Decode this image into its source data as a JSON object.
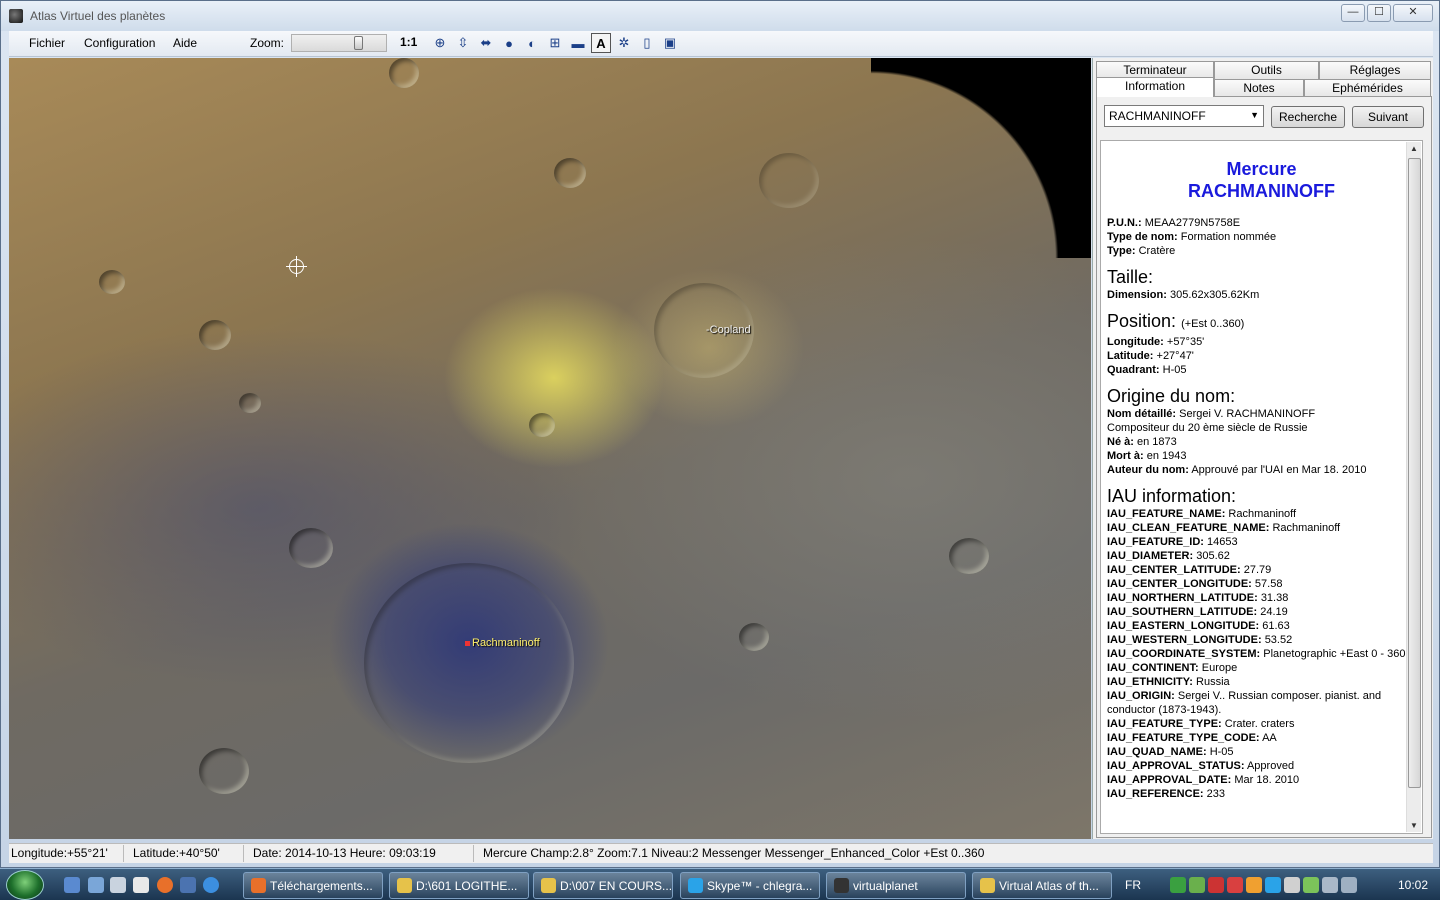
{
  "window": {
    "title": "Atlas Virtuel des planètes",
    "minimize": "—",
    "maximize": "☐",
    "close": "✕"
  },
  "menu": {
    "file": "Fichier",
    "config": "Configuration",
    "help": "Aide"
  },
  "toolbar": {
    "zoom_label": "Zoom:",
    "zoom_ratio": "1:1",
    "zoom_level": 0.65,
    "tools": [
      {
        "name": "globe-grid-icon",
        "glyph": "⊕"
      },
      {
        "name": "flip-vertical-icon",
        "glyph": "⇳"
      },
      {
        "name": "flip-horizontal-icon",
        "glyph": "⬌"
      },
      {
        "name": "planet-icon",
        "glyph": "●"
      },
      {
        "name": "terminator-icon",
        "glyph": "◐"
      },
      {
        "name": "grid-globe-icon",
        "glyph": "⊞"
      },
      {
        "name": "ruler-icon",
        "glyph": "▬"
      },
      {
        "name": "labels-icon",
        "glyph": "A"
      },
      {
        "name": "settings-icon",
        "glyph": "✲"
      },
      {
        "name": "page-icon",
        "glyph": "▯"
      },
      {
        "name": "screen-icon",
        "glyph": "▣"
      }
    ]
  },
  "map": {
    "labels": {
      "copland": "-Copland",
      "rachmaninoff": "Rachmaninoff"
    }
  },
  "panel": {
    "tabs_top": [
      "Terminateur",
      "Outils",
      "Réglages"
    ],
    "tabs_bottom": [
      "Information",
      "Notes",
      "Ephémérides"
    ],
    "search_value": "RACHMANINOFF",
    "search_button": "Recherche",
    "next_button": "Suivant",
    "info": {
      "planet": "Mercure",
      "feature": "RACHMANINOFF",
      "pun_label": "P.U.N.:",
      "pun": "MEAA2779N5758E",
      "typename_label": "Type de nom:",
      "typename": "Formation nommée",
      "type_label": "Type:",
      "type": "Cratère",
      "size_header": "Taille:",
      "dimension_label": "Dimension:",
      "dimension": "305.62x305.62Km",
      "position_header": "Position:",
      "position_note": "(+Est 0..360)",
      "lon_label": "Longitude:",
      "lon": "+57°35'",
      "lat_label": "Latitude:",
      "lat": "+27°47'",
      "quad_label": "Quadrant:",
      "quad": "H-05",
      "origin_header": "Origine du nom:",
      "detail_label": "Nom détaillé:",
      "detail": "Sergei V. RACHMANINOFF",
      "detail_line": "Compositeur  du 20 ème siècle de Russie",
      "born_label": "Né à:",
      "born": " en 1873",
      "died_label": "Mort à:",
      "died": " en 1943",
      "author_label": "Auteur du nom:",
      "author": "Approuvé par l'UAI en Mar 18. 2010",
      "iau_header": "IAU information:",
      "iau": [
        {
          "k": "IAU_FEATURE_NAME:",
          "v": "Rachmaninoff"
        },
        {
          "k": "IAU_CLEAN_FEATURE_NAME:",
          "v": "Rachmaninoff"
        },
        {
          "k": "IAU_FEATURE_ID:",
          "v": "14653"
        },
        {
          "k": "IAU_DIAMETER:",
          "v": "305.62"
        },
        {
          "k": "IAU_CENTER_LATITUDE:",
          "v": "27.79"
        },
        {
          "k": "IAU_CENTER_LONGITUDE:",
          "v": "57.58"
        },
        {
          "k": "IAU_NORTHERN_LATITUDE:",
          "v": "31.38"
        },
        {
          "k": "IAU_SOUTHERN_LATITUDE:",
          "v": "24.19"
        },
        {
          "k": "IAU_EASTERN_LONGITUDE:",
          "v": "61.63"
        },
        {
          "k": "IAU_WESTERN_LONGITUDE:",
          "v": "53.52"
        },
        {
          "k": "IAU_COORDINATE_SYSTEM:",
          "v": "Planetographic +East 0 - 360"
        },
        {
          "k": "IAU_CONTINENT:",
          "v": "Europe"
        },
        {
          "k": "IAU_ETHNICITY:",
          "v": "Russia"
        },
        {
          "k": "IAU_ORIGIN:",
          "v": "Sergei V.. Russian composer. pianist. and conductor (1873-1943)."
        },
        {
          "k": "IAU_FEATURE_TYPE:",
          "v": "Crater. craters"
        },
        {
          "k": "IAU_FEATURE_TYPE_CODE:",
          "v": "AA"
        },
        {
          "k": "IAU_QUAD_NAME:",
          "v": "H-05"
        },
        {
          "k": "IAU_APPROVAL_STATUS:",
          "v": "Approved"
        },
        {
          "k": "IAU_APPROVAL_DATE:",
          "v": "Mar 18. 2010"
        },
        {
          "k": "IAU_REFERENCE:",
          "v": "233"
        }
      ]
    }
  },
  "status": {
    "longitude": "Longitude:+55°21'",
    "latitude": "Latitude:+40°50'",
    "datetime": "Date: 2014-10-13   Heure: 09:03:19",
    "view": "Mercure Champ:2.8° Zoom:7.1  Niveau:2 Messenger Messenger_Enhanced_Color +Est 0..360"
  },
  "taskbar": {
    "start": "Start",
    "tasks": [
      {
        "label": "Téléchargements...",
        "color": "#e8702a"
      },
      {
        "label": "D:\\601 LOGITHE...",
        "color": "#e6c24a"
      },
      {
        "label": "D:\\007 EN COURS...",
        "color": "#e6c24a"
      },
      {
        "label": "Skype™ - chlegra...",
        "color": "#2aa3e8"
      },
      {
        "label": "virtualplanet",
        "color": "#333333"
      },
      {
        "label": "Virtual Atlas of th...",
        "color": "#e6c24a"
      }
    ],
    "lang": "FR",
    "clock": "10:02"
  }
}
